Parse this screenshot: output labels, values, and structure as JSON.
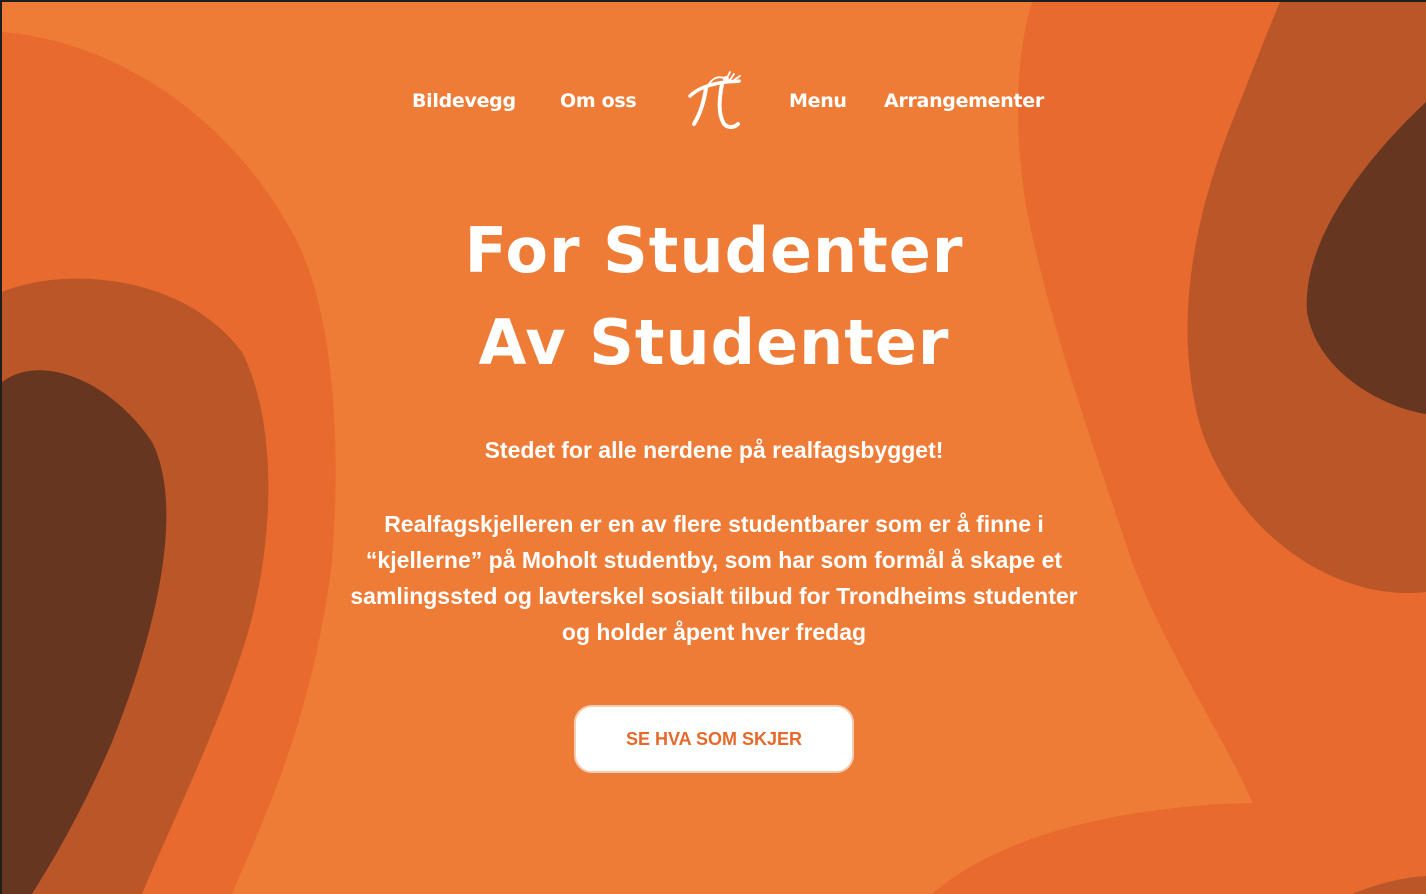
{
  "nav": {
    "left": [
      {
        "label": "Bildevegg"
      },
      {
        "label": "Om oss"
      }
    ],
    "logo_icon": "pi-figure-logo-icon",
    "right": [
      {
        "label": "Menu"
      },
      {
        "label": "Arrangementer"
      }
    ]
  },
  "hero": {
    "title_line1": "For Studenter",
    "title_line2": "Av Studenter",
    "tagline": "Stedet for alle nerdene på realfagsbygget!",
    "description": "Realfagskjelleren er en av flere studentbarer som er å finne i “kjellerne” på Moholt studentby, som har som formål å skape et samlingssted og lavterskel sosialt tilbud for Trondheims studenter og holder åpent hver fredag",
    "cta_label": "SE HVA SOM SKJER"
  },
  "colors": {
    "background": "#ee7c36",
    "blob_mid": "#e86a2e",
    "blob_dark": "#bb5629",
    "blob_darkest": "#663621",
    "text": "#ffffff",
    "cta_text": "#e4692b"
  }
}
